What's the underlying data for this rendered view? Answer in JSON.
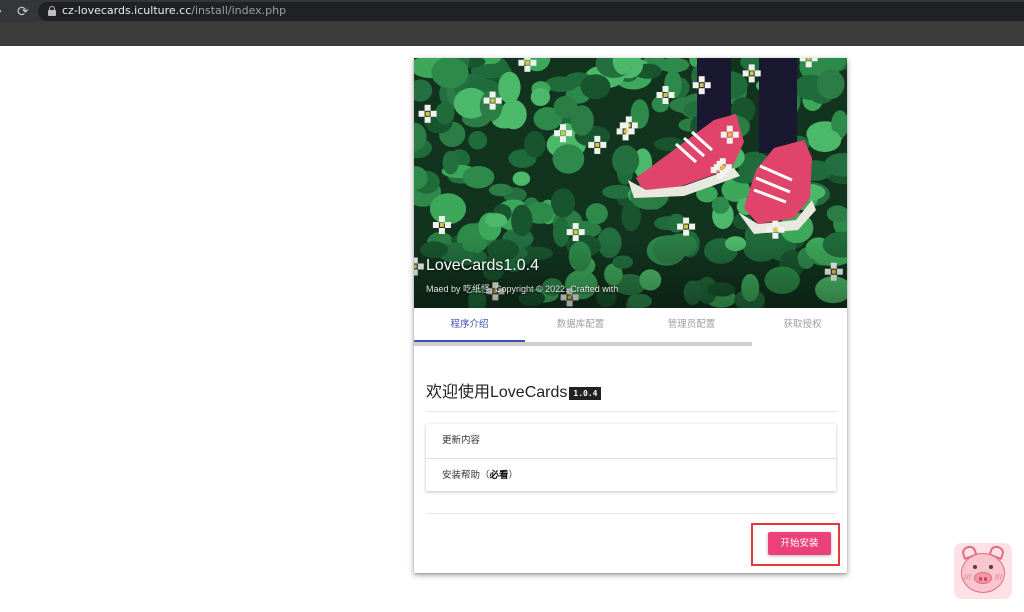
{
  "browser": {
    "url_domain": "cz-lovecards.iculture.cc",
    "url_path": "/install/index.php"
  },
  "hero": {
    "title": "LoveCards1.0.4",
    "subtitle": "Maed by 吃纸怪, Copyright © 2022. Crafted with"
  },
  "tabs": [
    {
      "label": "程序介绍",
      "active": true
    },
    {
      "label": "数据库配置",
      "active": false
    },
    {
      "label": "管理员配置",
      "active": false
    },
    {
      "label": "获取授权",
      "active": false
    }
  ],
  "main": {
    "welcome_title": "欢迎使用LoveCards",
    "version_badge": "1.0.4",
    "sections": [
      {
        "label": "更新内容"
      },
      {
        "label_prefix": "安装帮助（",
        "label_bold": "必看",
        "label_suffix": "）"
      }
    ],
    "install_button": "开始安装"
  },
  "colors": {
    "accent": "#3f51b5",
    "button": "#ec407a",
    "highlight": "#e53935"
  }
}
